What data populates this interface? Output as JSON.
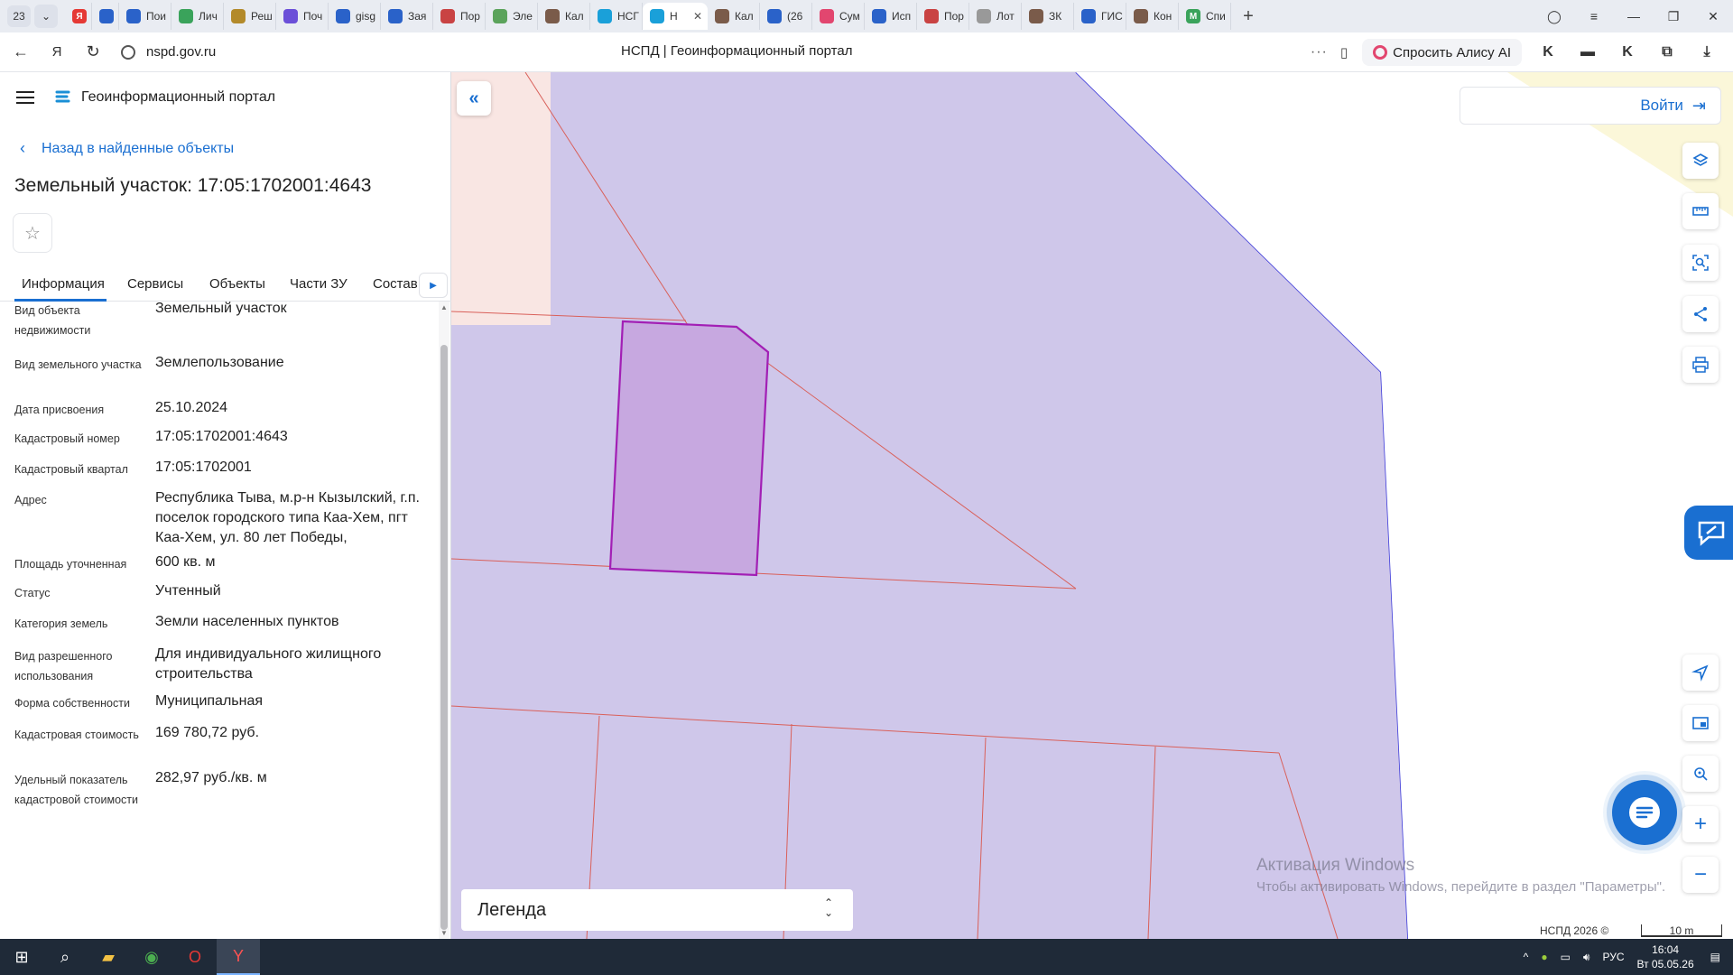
{
  "browser": {
    "tab_count": "23",
    "tabs": [
      {
        "label": "Пои",
        "color": "#2a62c9",
        "glyph": ""
      },
      {
        "label": "Лич",
        "color": "#3aa35b",
        "glyph": ""
      },
      {
        "label": "Реш",
        "color": "#b38a2a",
        "glyph": ""
      },
      {
        "label": "Поч",
        "color": "#6b4fd8",
        "glyph": ""
      },
      {
        "label": "gisg",
        "color": "#2a62c9",
        "glyph": ""
      },
      {
        "label": "Зая",
        "color": "#2a62c9",
        "glyph": ""
      },
      {
        "label": "Пор",
        "color": "#c94343",
        "glyph": ""
      },
      {
        "label": "Эле",
        "color": "#5ba35b",
        "glyph": ""
      },
      {
        "label": "Кал",
        "color": "#7a5b4a",
        "glyph": ""
      },
      {
        "label": "НСГ",
        "color": "#1aa0d9",
        "glyph": ""
      },
      {
        "label": "Кал",
        "color": "#7a5b4a",
        "glyph": ""
      },
      {
        "label": "(26",
        "color": "#2a62c9",
        "glyph": ""
      },
      {
        "label": "Сум",
        "color": "#e2466f",
        "glyph": ""
      },
      {
        "label": "Исп",
        "color": "#2a62c9",
        "glyph": ""
      },
      {
        "label": "Пор",
        "color": "#c94343",
        "glyph": ""
      },
      {
        "label": "Лот",
        "color": "#999999",
        "glyph": ""
      },
      {
        "label": "ЗК",
        "color": "#7a5b4a",
        "glyph": ""
      },
      {
        "label": "ГИС",
        "color": "#2a62c9",
        "glyph": ""
      },
      {
        "label": "Кон",
        "color": "#7a5b4a",
        "glyph": ""
      },
      {
        "label": "Спи",
        "color": "#3aa35b",
        "glyph": "M"
      }
    ],
    "active_tab_label": "Н",
    "url": "nspd.gov.ru",
    "page_title": "НСПД | Геоинформационный портал",
    "alice_label": "Спросить Алису AI"
  },
  "panel": {
    "portal_name": "Геоинформационный портал",
    "back_label": "Назад в найденные объекты",
    "object_title": "Земельный участок: 17:05:1702001:4643",
    "tabs": [
      "Информация",
      "Сервисы",
      "Объекты",
      "Части ЗУ",
      "Состав"
    ],
    "fields": [
      {
        "label": "Вид объекта недвижимости",
        "value": "Земельный участок"
      },
      {
        "label": "Вид земельного участка",
        "value": "Землепользование"
      },
      {
        "label": "Дата присвоения",
        "value": "25.10.2024"
      },
      {
        "label": "Кадастровый номер",
        "value": "17:05:1702001:4643"
      },
      {
        "label": "Кадастровый квартал",
        "value": "17:05:1702001"
      },
      {
        "label": "Адрес",
        "value": "Республика Тыва, м.р-н Кызылский, г.п. поселок городского типа Каа-Хем, пгт Каа-Хем, ул. 80 лет Победы,"
      },
      {
        "label": "Площадь уточненная",
        "value": "600 кв. м"
      },
      {
        "label": "Статус",
        "value": "Учтенный"
      },
      {
        "label": "Категория земель",
        "value": "Земли населенных пунктов"
      },
      {
        "label": "Вид разрешенного использования",
        "value": "Для индивидуального жилищного строительства"
      },
      {
        "label": "Форма собственности",
        "value": "Муниципальная"
      },
      {
        "label": "Кадастровая стоимость",
        "value": "169 780,72 руб."
      },
      {
        "label": "Удельный показатель кадастровой стоимости",
        "value": "282,97 руб./кв. м"
      }
    ]
  },
  "map": {
    "login_label": "Войти",
    "legend_label": "Легенда",
    "watermark_title": "Активация Windows",
    "watermark_text": "Чтобы активировать Windows, перейдите в раздел \"Параметры\".",
    "copyright": "НСПД 2026 ©",
    "scale_label": "10 m",
    "colors": {
      "zone_fill": "#cfc7ea",
      "parcel_fill": "#c7a8e0",
      "parcel_stroke": "#a21fb5",
      "zone_stroke": "#3d3bd9",
      "cadastral_line": "#d9605a",
      "accent": "#1a6fd1"
    }
  },
  "taskbar": {
    "lang": "РУС",
    "time": "16:04",
    "date": "Вт 05.05.26"
  }
}
